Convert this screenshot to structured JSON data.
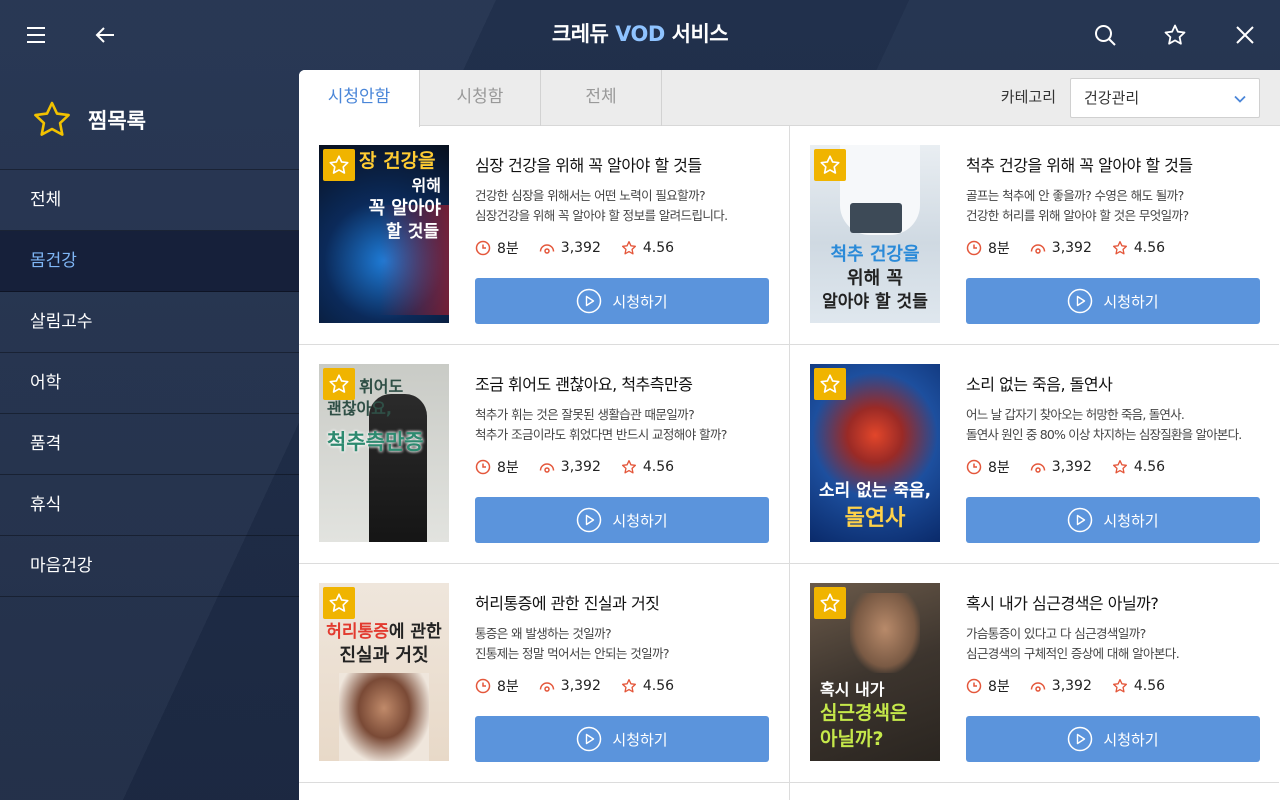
{
  "header": {
    "title_prefix": "크레듀 ",
    "title_accent": "VOD",
    "title_suffix": " 서비스",
    "icons": [
      "menu-icon",
      "back-icon",
      "search-icon",
      "star-icon",
      "close-icon"
    ]
  },
  "sidebar": {
    "heading": "찜목록",
    "items": [
      {
        "label": "전체",
        "active": false
      },
      {
        "label": "몸건강",
        "active": true
      },
      {
        "label": "살림고수",
        "active": false
      },
      {
        "label": "어학",
        "active": false
      },
      {
        "label": "품격",
        "active": false
      },
      {
        "label": "휴식",
        "active": false
      },
      {
        "label": "마음건강",
        "active": false
      }
    ]
  },
  "tabs": [
    {
      "label": "시청안함",
      "active": true
    },
    {
      "label": "시청함",
      "active": false
    },
    {
      "label": "전체",
      "active": false
    }
  ],
  "category": {
    "label": "카테고리",
    "selected": "건강관리"
  },
  "colors": {
    "accent": "#5b94dc",
    "star": "#f0b400",
    "meta_icon": "#e4573b",
    "sidebar_active": "#7fb6f5"
  },
  "cards": [
    {
      "title": "심장 건강을 위해 꼭 알아야 할 것들",
      "desc1": "건강한 심장을 위해서는 어떤 노력이 필요할까?",
      "desc2": "심장건강을 위해 꼭 알아야 할 정보를 알려드립니다.",
      "duration": "8분",
      "views": "3,392",
      "rating": "4.56",
      "play": "시청하기",
      "thumb": {
        "l1": "장 건강을",
        "l2": "위해",
        "l3": "꼭 알아야",
        "l4": "할 것들"
      }
    },
    {
      "title": "척추 건강을 위해 꼭 알아야 할 것들",
      "desc1": "골프는 척추에 안 좋을까? 수영은 해도 될까?",
      "desc2": "건강한 허리를 위해 알아야 할 것은 무엇일까?",
      "duration": "8분",
      "views": "3,392",
      "rating": "4.56",
      "play": "시청하기",
      "thumb": {
        "l1": "척추 건강을",
        "l2": "위해 꼭",
        "l3": "알아야 할 것들"
      }
    },
    {
      "title": "조금 휘어도 괜찮아요, 척추측만증",
      "desc1": "척추가 휘는 것은 잘못된 생활습관 때문일까?",
      "desc2": "척추가 조금이라도 휘었다면 반드시 교정해야 할까?",
      "duration": "8분",
      "views": "3,392",
      "rating": "4.56",
      "play": "시청하기",
      "thumb": {
        "l1": "휘어도",
        "l2": "괜찮아요,",
        "l3": "척추측만증"
      }
    },
    {
      "title": "소리 없는 죽음, 돌연사",
      "desc1": "어느 날 갑자기 찾아오는 허망한 죽음, 돌연사.",
      "desc2": "돌연사 원인 중 80% 이상 차지하는 심장질환을 알아본다.",
      "duration": "8분",
      "views": "3,392",
      "rating": "4.56",
      "play": "시청하기",
      "thumb": {
        "l1": "소리 없는 죽음,",
        "l2": "돌연사"
      }
    },
    {
      "title": "허리통증에 관한 진실과 거짓",
      "desc1": "통증은 왜 발생하는 것일까?",
      "desc2": "진통제는 정말 먹어서는 안되는 것일까?",
      "duration": "8분",
      "views": "3,392",
      "rating": "4.56",
      "play": "시청하기",
      "thumb": {
        "l1a": "허리통증",
        "l1b": "에 관한",
        "l2": "진실과 거짓"
      }
    },
    {
      "title": "혹시 내가 심근경색은 아닐까?",
      "desc1": "가슴통증이 있다고 다 심근경색일까?",
      "desc2": "심근경색의 구체적인 증상에 대해 알아본다.",
      "duration": "8분",
      "views": "3,392",
      "rating": "4.56",
      "play": "시청하기",
      "thumb": {
        "l1": "혹시 내가",
        "l2": "심근경색은",
        "l3": "아닐까?"
      }
    }
  ]
}
